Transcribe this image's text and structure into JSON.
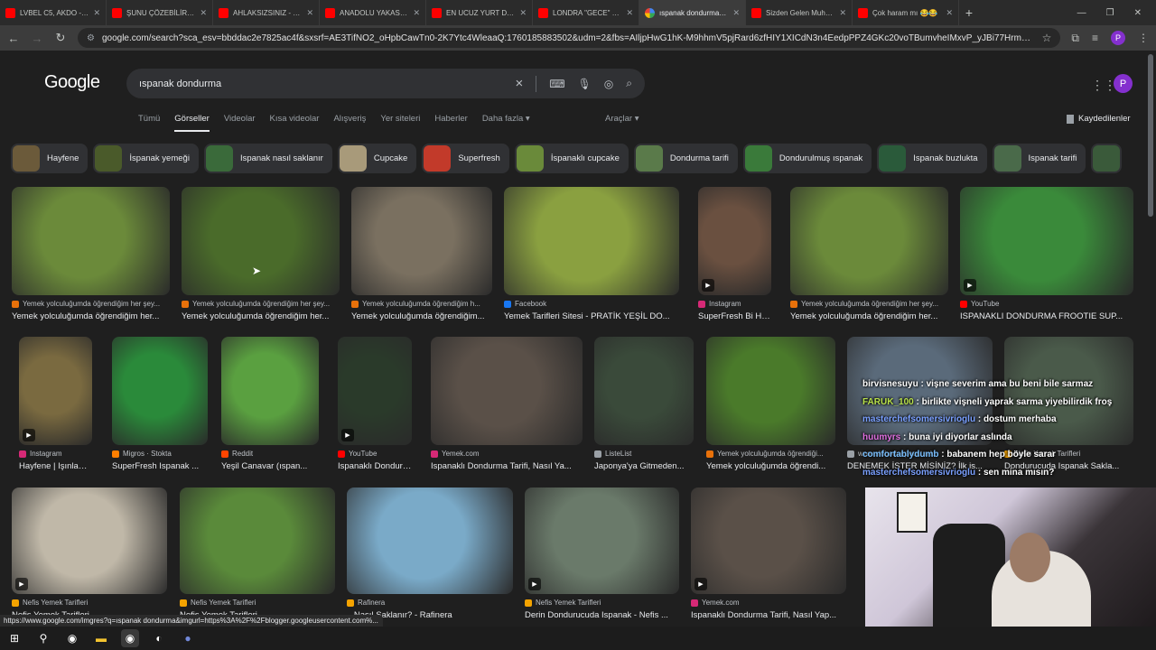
{
  "browser": {
    "tabs": [
      {
        "title": "LVBEL C5, AKDO - Mİ",
        "icon": "youtube-icon"
      },
      {
        "title": "ŞUNU ÇÖZEBİLİR Mİ...",
        "icon": "youtube-icon"
      },
      {
        "title": "AHLAKSIZSINIZ - Lut",
        "icon": "youtube-icon"
      },
      {
        "title": "ANADOLU YAKASI SO",
        "icon": "youtube-icon"
      },
      {
        "title": "EN UCUZ YURT DIŞI",
        "icon": "youtube-icon"
      },
      {
        "title": "LONDRA \"GECE\" YEM",
        "icon": "youtube-icon"
      },
      {
        "title": "ıspanak dondurma - G",
        "icon": "google-icon",
        "active": true
      },
      {
        "title": "Sizden Gelen Muhafa",
        "icon": "youtube-icon"
      },
      {
        "title": "Çok haram mı 😂😂",
        "icon": "youtube-icon"
      }
    ],
    "new_tab": "+",
    "url": "google.com/search?sca_esv=bbddac2e7825ac4f&sxsrf=AE3TifNO2_oHpbCawTn0-2K7Ytc4WleaaQ:1760185883502&udm=2&fbs=AIljpHwG1hK-M9hhmV5pjRard6zfHIY1XICdN3n4EedpPPZ4GKc20voTBumvheIMxvP_yJBi77HrmN_kA-35KjNTfguoozUIz..."
  },
  "google": {
    "logo": "Google",
    "query": "ıspanak dondurma",
    "tabs": [
      "Tümü",
      "Görseller",
      "Videolar",
      "Kısa videolar",
      "Alışveriş",
      "Yer siteleri",
      "Haberler",
      "Daha fazla ▾"
    ],
    "active_tab": "Görseller",
    "tools": "Araçlar ▾",
    "saved": "Kaydedilenler",
    "avatar": "P"
  },
  "chips": [
    {
      "label": "Hayfene",
      "color": "#6b5a3a"
    },
    {
      "label": "İspanak yemeği",
      "color": "#4a5a2a"
    },
    {
      "label": "Ispanak nasıl saklanır",
      "color": "#3a6a3a"
    },
    {
      "label": "Cupcake",
      "color": "#a89a7a"
    },
    {
      "label": "Superfresh",
      "color": "#c23a2a"
    },
    {
      "label": "İspanaklı cupcake",
      "color": "#6a8a3a"
    },
    {
      "label": "Dondurma tarifi",
      "color": "#5a7a4a"
    },
    {
      "label": "Dondurulmuş ıspanak",
      "color": "#3a7a3a"
    },
    {
      "label": "Ispanak buzlukta",
      "color": "#2a5a3a"
    },
    {
      "label": "Ispanak tarifi",
      "color": "#4a6a4a"
    },
    {
      "label": "",
      "color": "#3a5a3a"
    }
  ],
  "rows": [
    [
      {
        "src": "Yemek yolculuğumda öğrendiğim her şey...",
        "cap": "Yemek yolculuğumda öğrendiğim her...",
        "src_color": "#e8710a",
        "color": "#6b8a3a",
        "video": false
      },
      {
        "src": "Yemek yolculuğumda öğrendiğim her şey...",
        "cap": "Yemek yolculuğumda öğrendiğim her...",
        "src_color": "#e8710a",
        "color": "#4a6b2a",
        "video": false
      },
      {
        "src": "Yemek yolculuğumda öğrendiğim h...",
        "cap": "Yemek yolculuğumda öğrendiğim...",
        "src_color": "#e8710a",
        "color": "#7a7060",
        "video": false
      },
      {
        "src": "Facebook",
        "cap": "Yemek Tarifleri Sitesi - PRATİK YEŞİL DO...",
        "src_color": "#1877f2",
        "color": "#8aa040",
        "video": false
      },
      {
        "src": "Instagram",
        "cap": "SuperFresh Bi Hay...",
        "src_color": "#d62976",
        "color": "#6a5040",
        "video": true
      },
      {
        "src": "Yemek yolculuğumda öğrendiğim her şey...",
        "cap": "Yemek yolculuğumda öğrendiğim her...",
        "src_color": "#e8710a",
        "color": "#6b8a3a",
        "video": false
      },
      {
        "src": "YouTube",
        "cap": "ISPANAKLI DONDURMA FROOTIE SUP...",
        "src_color": "#ff0000",
        "color": "#3a8a3a",
        "video": true
      }
    ],
    [
      {
        "src": "Instagram",
        "cap": "Hayfene | Işınlama...",
        "src_color": "#d62976",
        "color": "#7a6a40",
        "video": true
      },
      {
        "src": "Migros · Stokta",
        "cap": "SuperFresh Ispanak ...",
        "src_color": "#ff7f00",
        "color": "#2a8a3a",
        "video": false
      },
      {
        "src": "Reddit",
        "cap": "Yeşil Canavar (ıspan...",
        "src_color": "#ff4500",
        "color": "#5aa040",
        "video": false
      },
      {
        "src": "YouTube",
        "cap": "Ispanaklı Dondurm...",
        "src_color": "#ff0000",
        "color": "#2a3a2a",
        "video": true
      },
      {
        "src": "Yemek.com",
        "cap": "Ispanaklı Dondurma Tarifi, Nasıl Ya...",
        "src_color": "#d62976",
        "color": "#5a5048",
        "video": false
      },
      {
        "src": "ListeList",
        "cap": "Japonya'ya Gitmeden...",
        "src_color": "#9aa0a6",
        "color": "#3a4a3a",
        "video": false
      },
      {
        "src": "Yemek yolculuğumda öğrendiği...",
        "cap": "Yemek yolculuğumda öğrendi...",
        "src_color": "#e8710a",
        "color": "#4a7a2a",
        "video": false
      },
      {
        "src": "www.slobodenpecat.mk",
        "cap": "DENEMEK İSTER MİSİNİZ? İlk is...",
        "src_color": "#9aa0a6",
        "color": "#5a6a7a",
        "video": false
      },
      {
        "src": "Nefis Yemek Tarifleri",
        "cap": "Dondurucuda Ispanak Sakla...",
        "src_color": "#f4a300",
        "color": "#4a5a4a",
        "video": false
      }
    ],
    [
      {
        "src": "Nefis Yemek Tarifleri",
        "cap": "Nefis Yemek Tarifleri",
        "src_color": "#f4a300",
        "color": "#c0b8a8",
        "video": true
      },
      {
        "src": "Nefis Yemek Tarifleri",
        "cap": "Nefis Yemek Tarifleri",
        "src_color": "#f4a300",
        "color": "#5a8a3a",
        "video": false
      },
      {
        "src": "Rafinera",
        "cap": "...Nasıl Saklanır? - Rafinera",
        "src_color": "#f4a300",
        "color": "#7aaac8",
        "video": false
      },
      {
        "src": "Nefis Yemek Tarifleri",
        "cap": "Derin Dondurucuda Ispanak - Nefis ...",
        "src_color": "#f4a300",
        "color": "#6a7a6a",
        "video": true
      },
      {
        "src": "Yemek.com",
        "cap": "Ispanaklı Dondurma Tarifi, Nasıl Yap...",
        "src_color": "#d62976",
        "color": "#5a5048",
        "video": true
      }
    ]
  ],
  "chat": [
    {
      "user": "birvisnesuyu",
      "msg": "vişne severim ama bu beni bile sarmaz",
      "color": "#ffffff"
    },
    {
      "user": "FARUK_100",
      "msg": "birlikte vişneli yaprak sarma yiyebilirdik froş",
      "color": "#b8e04a"
    },
    {
      "user": "masterchefsomersivrioglu",
      "msg": "dostum merhaba",
      "color": "#7aa0ff"
    },
    {
      "user": "huumyrs",
      "msg": "buna iyi diyorlar aslında",
      "color": "#e070e0"
    },
    {
      "user": "comfortablydumb",
      "msg": "babanem hep böyle sarar",
      "color": "#7ac0ff"
    },
    {
      "user": "masterchefsomersivrioglu",
      "msg": "sen mina mısın?",
      "color": "#7aa0ff"
    }
  ],
  "status_url": "https://www.google.com/imgres?q=ıspanak dondurma&imgurl=https%3A%2F%2Fblogger.googleusercontent.com%..."
}
